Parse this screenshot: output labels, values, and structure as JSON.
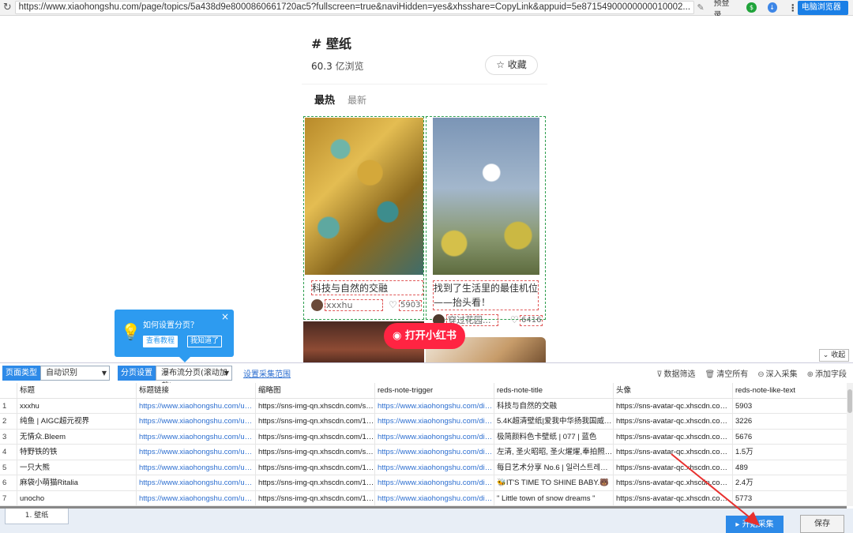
{
  "browser": {
    "url": "https://www.xiaohongshu.com/page/topics/5a438d9e8000860661720ac5?fullscreen=true&naviHidden=yes&xhsshare=CopyLink&appuid=5e87154900000000010002...",
    "login_label": "预登录",
    "pc_browser_label": "电脑浏览器"
  },
  "topic": {
    "title": "# 壁纸",
    "views_number": "60.3",
    "views_unit": "亿浏览",
    "favorite_label": "☆ 收藏",
    "tab_hot": "最热",
    "tab_new": "最新"
  },
  "cards": [
    {
      "title": "科技与自然的交融",
      "author": "xxxhu",
      "likes": "5903"
    },
    {
      "title": "找到了生活里的最佳机位——抬头看！",
      "author": "穿过花园...",
      "likes": "6416"
    }
  ],
  "open_app_label": "打开小红书",
  "tooltip": {
    "title": "如何设置分页？",
    "view_tutorial": "查看教程",
    "got_it": "我知道了",
    "close": "×"
  },
  "collapse_label": "收起",
  "toolbar": {
    "page_type_label": "页面类型",
    "page_type_value": "自动识别",
    "pagination_label": "分页设置",
    "pagination_value": "瀑布流分页(滚动加载)",
    "range_link": "设置采集范围",
    "filter": "数据筛选",
    "clear": "清空所有",
    "deep": "深入采集",
    "add_field": "添加字段"
  },
  "table": {
    "columns": [
      "",
      "标题",
      "标题链接",
      "缩略图",
      "reds-note-trigger",
      "reds-note-title",
      "头像",
      "reds-note-like-text"
    ],
    "rows": [
      [
        "1",
        "xxxhu",
        "https://www.xiaohongshu.com/user/...",
        "https://sns-img-qn.xhscdn.com/spect...",
        "https://www.xiaohongshu.com/disco...",
        "科技与自然的交融",
        "https://sns-avatar-qc.xhscdn.com/av...",
        "5903"
      ],
      [
        "2",
        "纯鱼 | AIGC超元视界",
        "https://www.xiaohongshu.com/user/...",
        "https://sns-img-qn.xhscdn.com/1040...",
        "https://www.xiaohongshu.com/disco...",
        "5.4K超清壁纸|爱我中华扬我国威 | 国...",
        "https://sns-avatar-qc.xhscdn.com/av...",
        "3226"
      ],
      [
        "3",
        "无情众.Bleem",
        "https://www.xiaohongshu.com/user/...",
        "https://sns-img-qn.xhscdn.com/1040...",
        "https://www.xiaohongshu.com/disco...",
        "极简颜料色卡壁纸 | 077 | 蓝色",
        "https://sns-avatar-qc.xhscdn.com/av...",
        "5676"
      ],
      [
        "4",
        "特野铁的铁",
        "https://www.xiaohongshu.com/user/...",
        "https://sns-img-qn.xhscdn.com/spect...",
        "https://www.xiaohongshu.com/disco...",
        "左清, 圣火昭昭, 圣火燿燿,奉拍照姿...",
        "https://sns-avatar-qc.xhscdn.com/av...",
        "1.5万"
      ],
      [
        "5",
        "一只大熊",
        "https://www.xiaohongshu.com/user/...",
        "https://sns-img-qn.xhscdn.com/1040...",
        "https://www.xiaohongshu.com/disco...",
        "每日艺术分享 No.6 | 일러스트레이...",
        "https://sns-avatar-qc.xhscdn.com/av...",
        "489"
      ],
      [
        "6",
        "麻袋小萌猫Ritalia",
        "https://www.xiaohongshu.com/user/...",
        "https://sns-img-qn.xhscdn.com/1000...",
        "https://www.xiaohongshu.com/disco...",
        "🐝IT'S TIME TO SHINE BABY.🐻",
        "https://sns-avatar-qc.xhscdn.com/av...",
        "2.4万"
      ],
      [
        "7",
        "unocho",
        "https://www.xiaohongshu.com/user/...",
        "https://sns-img-qn.xhscdn.com/1040...",
        "https://www.xiaohongshu.com/disco...",
        "\" Little town of snow dreams \"",
        "https://sns-avatar-qc.xhscdn.com/av...",
        "5773"
      ]
    ]
  },
  "footer": {
    "page_tab": "1. 壁纸",
    "start_label": "▸ 开始采集",
    "save_label": "保存"
  },
  "colors": {
    "accent_blue": "#2d8ae8",
    "xhs_red": "#ff2442",
    "annotation_arrow": "#e8302e"
  }
}
